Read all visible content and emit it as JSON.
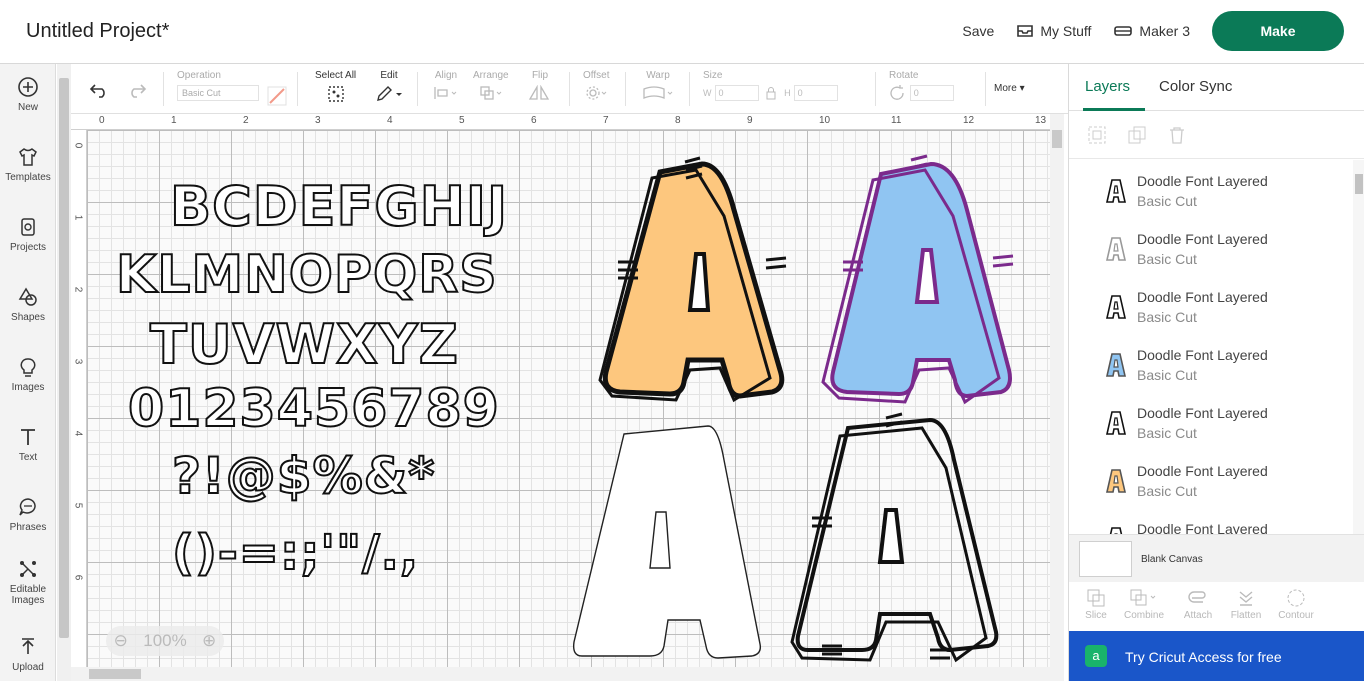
{
  "header": {
    "title": "Untitled Project*",
    "save_label": "Save",
    "mystuff_label": "My Stuff",
    "machine_label": "Maker 3",
    "make_label": "Make"
  },
  "sidebar": {
    "items": [
      {
        "label": "New",
        "icon": "plus-circle-icon"
      },
      {
        "label": "Templates",
        "icon": "shirt-icon"
      },
      {
        "label": "Projects",
        "icon": "projects-icon"
      },
      {
        "label": "Shapes",
        "icon": "shapes-icon"
      },
      {
        "label": "Images",
        "icon": "lightbulb-icon"
      },
      {
        "label": "Text",
        "icon": "text-icon"
      },
      {
        "label": "Phrases",
        "icon": "speech-bubble-icon"
      },
      {
        "label": "Editable",
        "label2": "Images",
        "icon": "editable-images-icon"
      },
      {
        "label": "Upload",
        "icon": "upload-icon"
      }
    ]
  },
  "toolbar": {
    "operation_label": "Operation",
    "operation_value": "Basic Cut",
    "select_all_label": "Select All",
    "edit_label": "Edit",
    "align_label": "Align",
    "arrange_label": "Arrange",
    "flip_label": "Flip",
    "offset_label": "Offset",
    "warp_label": "Warp",
    "size_label": "Size",
    "w_label": "W",
    "h_label": "H",
    "w_value": "0",
    "h_value": "0",
    "rotate_label": "Rotate",
    "rotate_value": "0",
    "more_label": "More"
  },
  "canvas": {
    "ruler_top": [
      "0",
      "1",
      "2",
      "3",
      "4",
      "5",
      "6",
      "7",
      "8",
      "9",
      "10",
      "11",
      "12",
      "13"
    ],
    "ruler_left": [
      "0",
      "1",
      "2",
      "3",
      "4",
      "5",
      "6"
    ],
    "zoom_value": "100%",
    "sheet_rows": [
      "BCDEFGHIJ",
      "KLMNOPQRS",
      "TUVWXYZ",
      "0123456789",
      "?!@$%&*",
      "()-=:;'\"/.,"
    ],
    "letter_glyph": "A",
    "colors": {
      "orange_fill": "#fdc77e",
      "blue_fill": "#90c5f2",
      "purple_outline": "#7b2a8c"
    }
  },
  "panel": {
    "tabs": [
      "Layers",
      "Color Sync"
    ],
    "active_tab": "Layers",
    "layers": [
      {
        "name": "Doodle Font Layered",
        "operation": "Basic Cut",
        "thumb": "black-outline"
      },
      {
        "name": "Doodle Font Layered",
        "operation": "Basic Cut",
        "thumb": "gray-outline"
      },
      {
        "name": "Doodle Font Layered",
        "operation": "Basic Cut",
        "thumb": "black-outline"
      },
      {
        "name": "Doodle Font Layered",
        "operation": "Basic Cut",
        "thumb": "blue-fill"
      },
      {
        "name": "Doodle Font Layered",
        "operation": "Basic Cut",
        "thumb": "black-outline"
      },
      {
        "name": "Doodle Font Layered",
        "operation": "Basic Cut",
        "thumb": "orange-fill"
      },
      {
        "name": "Doodle Font Layered",
        "operation": "",
        "thumb": "black-outline"
      }
    ],
    "blank_canvas_label": "Blank Canvas",
    "bottom_tools": [
      "Slice",
      "Combine",
      "Attach",
      "Flatten",
      "Contour"
    ],
    "access_text": "Try Cricut Access for free",
    "access_icon_letter": "a"
  }
}
